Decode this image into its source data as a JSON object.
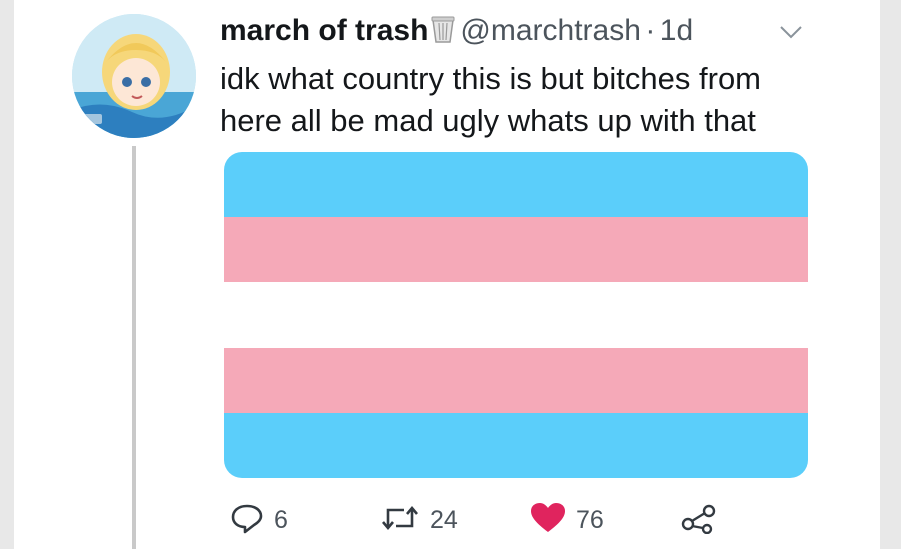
{
  "tweet": {
    "display_name": "march of trash",
    "handle": "@marchtrash",
    "separator": "·",
    "time": "1d",
    "text_lines": [
      "idk what country this is but bitches from",
      "here all be mad ugly whats up with that"
    ],
    "media": {
      "stripe_colors": [
        "#5bcefa",
        "#f5a9b8",
        "#ffffff",
        "#f5a9b8",
        "#5bcefa"
      ]
    },
    "actions": {
      "reply_count": "6",
      "retweet_count": "24",
      "like_count": "76"
    },
    "icons": {
      "name_emoji": "wastebasket-icon",
      "more": "chevron-down-icon",
      "reply": "reply-icon",
      "retweet": "retweet-icon",
      "like": "heart-icon",
      "share": "share-icon"
    },
    "colors": {
      "like_active": "#e0245e",
      "secondary_text": "#4c545c",
      "primary_text": "#14171a"
    }
  }
}
